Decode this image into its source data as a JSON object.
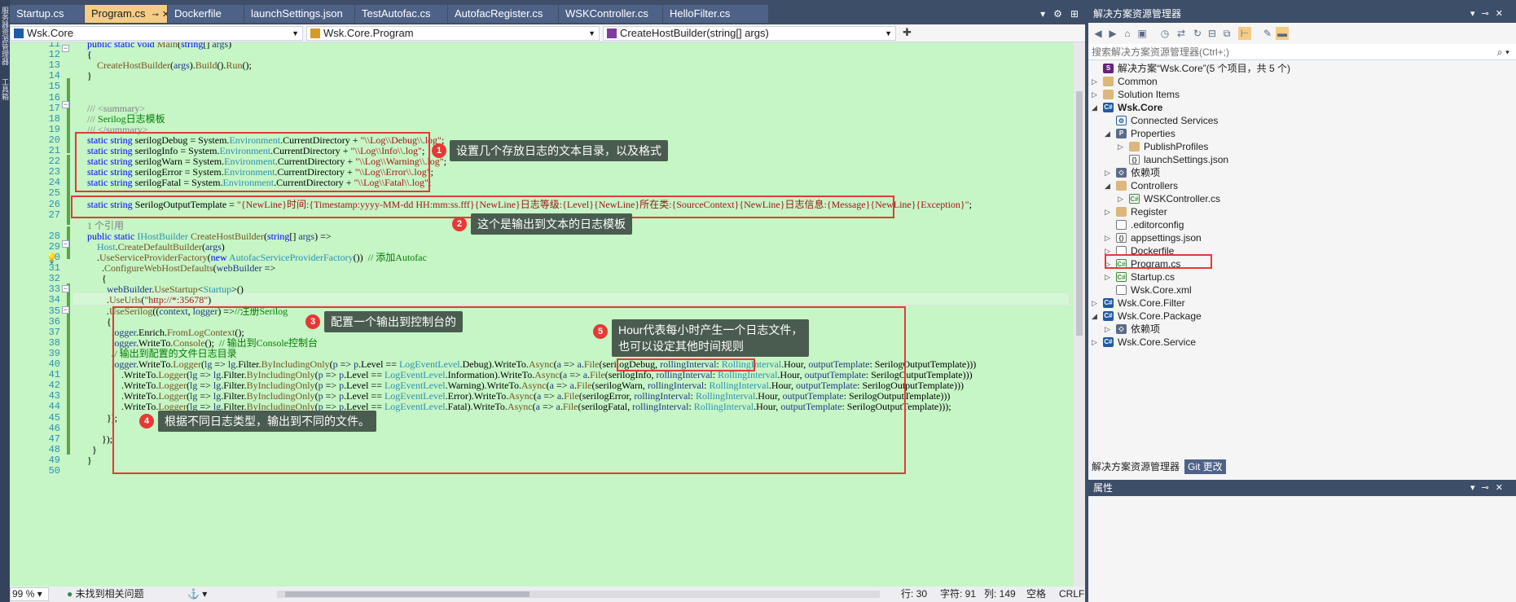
{
  "left_strip": {
    "labels": [
      "服务器资源管理器",
      "工具箱"
    ]
  },
  "tabs": [
    {
      "label": "Startup.cs",
      "active": false
    },
    {
      "label": "Program.cs",
      "active": true
    },
    {
      "label": "Dockerfile",
      "active": false
    },
    {
      "label": "launchSettings.json",
      "active": false
    },
    {
      "label": "TestAutofac.cs",
      "active": false
    },
    {
      "label": "AutofacRegister.cs",
      "active": false
    },
    {
      "label": "WSKController.cs",
      "active": false
    },
    {
      "label": "HelloFilter.cs",
      "active": false
    }
  ],
  "nav": {
    "project": "Wsk.Core",
    "class": "Wsk.Core.Program",
    "member": "CreateHostBuilder(string[] args)"
  },
  "code_lines": [
    {
      "n": "11",
      "html": "<span class='kw'>public static void</span> <span class='ex'>Main</span>(<span class='kw'>string</span>[] <span class='pm'>args</span>)"
    },
    {
      "n": "12",
      "html": "{"
    },
    {
      "n": "13",
      "html": "    <span class='ex'>CreateHostBuilder</span>(<span class='pm'>args</span>).<span class='ex'>Build</span>().<span class='ex'>Run</span>();"
    },
    {
      "n": "14",
      "html": "}"
    },
    {
      "n": "15",
      "html": ""
    },
    {
      "n": "16",
      "html": ""
    },
    {
      "n": "17",
      "html": "<span class='gr'>/// &lt;summary&gt;</span>"
    },
    {
      "n": "18",
      "html": "<span class='gr'>/// </span><span class='cm'>Serilog日志模板</span>"
    },
    {
      "n": "19",
      "html": "<span class='gr'>/// &lt;/summary&gt;</span>"
    },
    {
      "n": "20",
      "html": "<span class='kw'>static string</span> serilogDebug = System.<span class='ty'>Environment</span>.CurrentDirectory + <span class='st'>\"\\\\Log\\\\Debug\\\\.log\"</span>;"
    },
    {
      "n": "21",
      "html": "<span class='kw'>static string</span> serilogInfo = System.<span class='ty'>Environment</span>.CurrentDirectory + <span class='st'>\"\\\\Log\\\\Info\\\\.log\"</span>;"
    },
    {
      "n": "22",
      "html": "<span class='kw'>static string</span> serilogWarn = System.<span class='ty'>Environment</span>.CurrentDirectory + <span class='st'>\"\\\\Log\\\\Warning\\\\.log\"</span>;"
    },
    {
      "n": "23",
      "html": "<span class='kw'>static string</span> serilogError = System.<span class='ty'>Environment</span>.CurrentDirectory + <span class='st'>\"\\\\Log\\\\Error\\\\.log\"</span>;"
    },
    {
      "n": "24",
      "html": "<span class='kw'>static string</span> serilogFatal = System.<span class='ty'>Environment</span>.CurrentDirectory + <span class='st'>\"\\\\Log\\\\Fatal\\\\.log\"</span>;"
    },
    {
      "n": "25",
      "html": ""
    },
    {
      "n": "26",
      "html": "<span class='kw'>static string</span> SerilogOutputTemplate = <span class='st'>\"{NewLine}时间:{Timestamp:yyyy-MM-dd HH:mm:ss.fff}{NewLine}日志等级:{Level}{NewLine}所在类:{SourceContext}{NewLine}日志信息:{Message}{NewLine}{Exception}\"</span>;"
    },
    {
      "n": "27",
      "html": ""
    },
    {
      "n": "",
      "html": "<span class='gr'>1 个引用</span>"
    },
    {
      "n": "28",
      "html": "<span class='kw'>public static</span> <span class='ty'>IHostBuilder</span> <span class='ex'>CreateHostBuilder</span>(<span class='kw'>string</span>[] <span class='pm'>args</span>) =>"
    },
    {
      "n": "29",
      "html": "    <span class='ty'>Host</span>.<span class='ex'>CreateDefaultBuilder</span>(<span class='pm'>args</span>)"
    },
    {
      "n": "30",
      "html": "    .<span class='ex'>UseServiceProviderFactory</span>(<span class='kw'>new</span> <span class='ty'>AutofacServiceProviderFactory</span>())  <span class='cm'>// 添加Autofac</span>"
    },
    {
      "n": "31",
      "html": "      .<span class='ex'>ConfigureWebHostDefaults</span>(<span class='pm'>webBuilder</span> =>"
    },
    {
      "n": "32",
      "html": "      {"
    },
    {
      "n": "33",
      "html": "        <span class='pm'>webBuilder</span>.<span class='ex'>UseStartup</span>&lt;<span class='ty'>Startup</span>&gt;()"
    },
    {
      "n": "34",
      "html": "        .<span class='ex'>UseUrls</span>(<span class='st'>\"http://*:35678\"</span>)"
    },
    {
      "n": "35",
      "html": "        .<span class='ex'>UseSerilog</span>((<span class='pm'>context</span>, <span class='pm'>logger</span>) =><span class='cm'>//注册Serilog</span>"
    },
    {
      "n": "36",
      "html": "        {"
    },
    {
      "n": "37",
      "html": "          <span class='pm'>logger</span>.Enrich.<span class='ex'>FromLogContext</span>();"
    },
    {
      "n": "38",
      "html": "          <span class='pm'>logger</span>.WriteTo.<span class='ex'>Console</span>();  <span class='cm'>// 输出到Console控制台</span>"
    },
    {
      "n": "39",
      "html": "          <span class='cm'>// 输出到配置的文件日志目录</span>"
    },
    {
      "n": "40",
      "html": "          <span class='pm'>logger</span>.WriteTo.<span class='ex'>Logger</span>(<span class='pm'>lg</span> => <span class='pm'>lg</span>.Filter.<span class='ex'>ByIncludingOnly</span>(<span class='pm'>p</span> => <span class='pm'>p</span>.Level == <span class='ty'>LogEventLevel</span>.Debug).WriteTo.<span class='ex'>Async</span>(<span class='pm'>a</span> => <span class='pm'>a</span>.<span class='ex'>File</span>(serilogDebug, <span class='pm'>rollingInterval</span>: <span class='ty'>RollingInterval</span>.Hour, <span class='pm'>outputTemplate</span>: SerilogOutputTemplate)))"
    },
    {
      "n": "41",
      "html": "              .WriteTo.<span class='ex'>Logger</span>(<span class='pm'>lg</span> => <span class='pm'>lg</span>.Filter.<span class='ex'>ByIncludingOnly</span>(<span class='pm'>p</span> => <span class='pm'>p</span>.Level == <span class='ty'>LogEventLevel</span>.Information).WriteTo.<span class='ex'>Async</span>(<span class='pm'>a</span> => <span class='pm'>a</span>.<span class='ex'>File</span>(serilogInfo, <span class='pm'>rollingInterval</span>: <span class='ty'>RollingInterval</span>.Hour, <span class='pm'>outputTemplate</span>: SerilogOutputTemplate)))"
    },
    {
      "n": "42",
      "html": "              .WriteTo.<span class='ex'>Logger</span>(<span class='pm'>lg</span> => <span class='pm'>lg</span>.Filter.<span class='ex'>ByIncludingOnly</span>(<span class='pm'>p</span> => <span class='pm'>p</span>.Level == <span class='ty'>LogEventLevel</span>.Warning).WriteTo.<span class='ex'>Async</span>(<span class='pm'>a</span> => <span class='pm'>a</span>.<span class='ex'>File</span>(serilogWarn, <span class='pm'>rollingInterval</span>: <span class='ty'>RollingInterval</span>.Hour, <span class='pm'>outputTemplate</span>: SerilogOutputTemplate)))"
    },
    {
      "n": "43",
      "html": "              .WriteTo.<span class='ex'>Logger</span>(<span class='pm'>lg</span> => <span class='pm'>lg</span>.Filter.<span class='ex'>ByIncludingOnly</span>(<span class='pm'>p</span> => <span class='pm'>p</span>.Level == <span class='ty'>LogEventLevel</span>.Error).WriteTo.<span class='ex'>Async</span>(<span class='pm'>a</span> => <span class='pm'>a</span>.<span class='ex'>File</span>(serilogError, <span class='pm'>rollingInterval</span>: <span class='ty'>RollingInterval</span>.Hour, <span class='pm'>outputTemplate</span>: SerilogOutputTemplate)))"
    },
    {
      "n": "44",
      "html": "              .WriteTo.<span class='ex'>Logger</span>(<span class='pm'>lg</span> => <span class='pm'>lg</span>.Filter.<span class='ex'>ByIncludingOnly</span>(<span class='pm'>p</span> => <span class='pm'>p</span>.Level == <span class='ty'>LogEventLevel</span>.Fatal).WriteTo.<span class='ex'>Async</span>(<span class='pm'>a</span> => <span class='pm'>a</span>.<span class='ex'>File</span>(serilogFatal, <span class='pm'>rollingInterval</span>: <span class='ty'>RollingInterval</span>.Hour, <span class='pm'>outputTemplate</span>: SerilogOutputTemplate)));"
    },
    {
      "n": "45",
      "html": "        });"
    },
    {
      "n": "46",
      "html": ""
    },
    {
      "n": "47",
      "html": "      });"
    },
    {
      "n": "48",
      "html": "  }"
    },
    {
      "n": "49",
      "html": "}"
    },
    {
      "n": "50",
      "html": ""
    }
  ],
  "annotations": [
    {
      "num": "1",
      "text": "设置几个存放日志的文本目录，以及格式"
    },
    {
      "num": "2",
      "text": "这个是输出到文本的日志模板"
    },
    {
      "num": "3",
      "text": "配置一个输出到控制台的"
    },
    {
      "num": "4",
      "text": "根据不同日志类型，输出到不同的文件。"
    },
    {
      "num": "5",
      "text": "Hour代表每小时产生一个日志文件，\n也可以设定其他时间规则"
    }
  ],
  "status": {
    "zoom": "99 %",
    "issues": "未找到相关问题",
    "line": "行: 30",
    "char": "字符: 91",
    "col": "列: 149",
    "whitespace": "空格",
    "eol": "CRLF"
  },
  "solution_explorer": {
    "title": "解决方案资源管理器",
    "search_placeholder": "搜索解决方案资源管理器(Ctrl+;)",
    "nodes": [
      {
        "label": "解决方案“Wsk.Core”(5 个项目，共 5 个)",
        "icon": "sln",
        "glyph": "S",
        "depth": 0,
        "tw": "",
        "bold": false
      },
      {
        "label": "Common",
        "icon": "folder",
        "glyph": "",
        "depth": 0,
        "tw": "▷",
        "bold": false
      },
      {
        "label": "Solution Items",
        "icon": "folder",
        "glyph": "",
        "depth": 0,
        "tw": "▷",
        "bold": false
      },
      {
        "label": "Wsk.Core",
        "icon": "proj",
        "glyph": "C#",
        "depth": 0,
        "tw": "◢",
        "bold": true
      },
      {
        "label": "Connected Services",
        "icon": "conn",
        "glyph": "⚙",
        "depth": 1,
        "tw": "",
        "bold": false
      },
      {
        "label": "Properties",
        "icon": "wrench",
        "glyph": "P",
        "depth": 1,
        "tw": "◢",
        "bold": false
      },
      {
        "label": "PublishProfiles",
        "icon": "folder",
        "glyph": "",
        "depth": 2,
        "tw": "▷",
        "bold": false
      },
      {
        "label": "launchSettings.json",
        "icon": "json",
        "glyph": "{}",
        "depth": 2,
        "tw": "",
        "bold": false
      },
      {
        "label": "依赖项",
        "icon": "dep",
        "glyph": "◇",
        "depth": 1,
        "tw": "▷",
        "bold": false
      },
      {
        "label": "Controllers",
        "icon": "folder",
        "glyph": "",
        "depth": 1,
        "tw": "◢",
        "bold": false
      },
      {
        "label": "WSKController.cs",
        "icon": "cs",
        "glyph": "C#",
        "depth": 2,
        "tw": "▷",
        "bold": false
      },
      {
        "label": "Register",
        "icon": "folder",
        "glyph": "",
        "depth": 1,
        "tw": "▷",
        "bold": false
      },
      {
        "label": ".editorconfig",
        "icon": "file",
        "glyph": "",
        "depth": 1,
        "tw": "",
        "bold": false
      },
      {
        "label": "appsettings.json",
        "icon": "json",
        "glyph": "{}",
        "depth": 1,
        "tw": "▷",
        "bold": false
      },
      {
        "label": "Dockerfile",
        "icon": "file",
        "glyph": "",
        "depth": 1,
        "tw": "▷",
        "bold": false
      },
      {
        "label": "Program.cs",
        "icon": "cs",
        "glyph": "C#",
        "depth": 1,
        "tw": "▷",
        "bold": false
      },
      {
        "label": "Startup.cs",
        "icon": "cs",
        "glyph": "C#",
        "depth": 1,
        "tw": "▷",
        "bold": false
      },
      {
        "label": "Wsk.Core.xml",
        "icon": "file",
        "glyph": "",
        "depth": 1,
        "tw": "",
        "bold": false
      },
      {
        "label": "Wsk.Core.Filter",
        "icon": "proj",
        "glyph": "C#",
        "depth": 0,
        "tw": "▷",
        "bold": false
      },
      {
        "label": "Wsk.Core.Package",
        "icon": "proj",
        "glyph": "C#",
        "depth": 0,
        "tw": "◢",
        "bold": false
      },
      {
        "label": "依赖项",
        "icon": "dep",
        "glyph": "◇",
        "depth": 1,
        "tw": "▷",
        "bold": false
      },
      {
        "label": "Wsk.Core.Service",
        "icon": "proj",
        "glyph": "C#",
        "depth": 0,
        "tw": "▷",
        "bold": false
      }
    ],
    "bottom_tabs": [
      "解决方案资源管理器",
      "Git 更改"
    ],
    "properties_title": "属性"
  },
  "colors": {
    "editor_bg": "#c6f5c6",
    "chrome": "#3d4e69",
    "active_tab": "#f5cc84",
    "annotation_red": "#e53935"
  }
}
